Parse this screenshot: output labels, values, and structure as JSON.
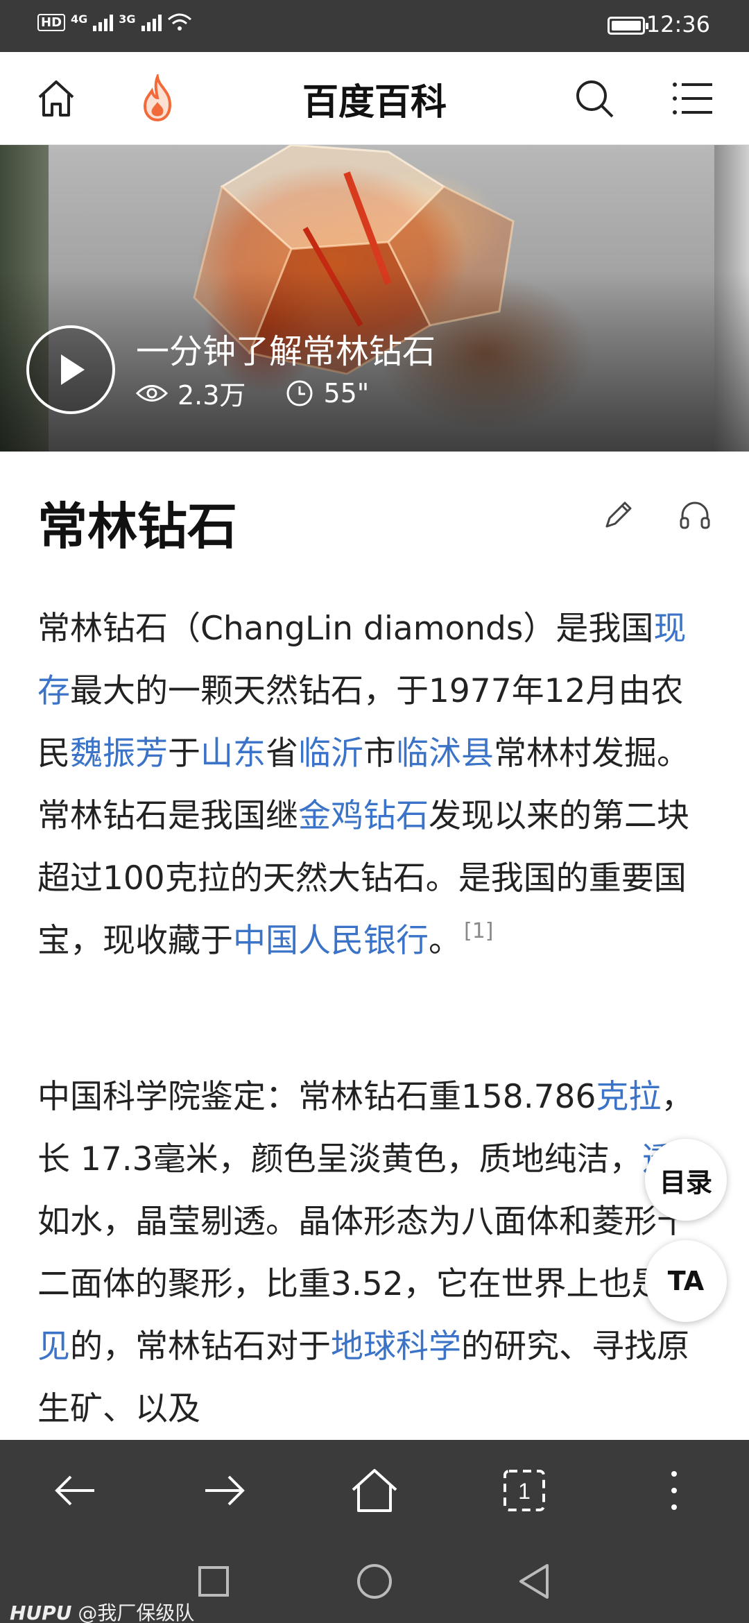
{
  "status_bar": {
    "hd": "HD",
    "sim1": "4G",
    "sim2": "3G",
    "time": "12:36"
  },
  "header": {
    "title": "百度百科",
    "icons": [
      "home-icon",
      "fire-icon",
      "search-icon",
      "menu-icon"
    ],
    "fire_color": "#f26a3a"
  },
  "video": {
    "title": "一分钟了解常林钻石",
    "views": "2.3万",
    "duration": "55\""
  },
  "article": {
    "title": "常林钻石",
    "link_color": "#3a73c7",
    "p1": [
      {
        "t": "常林钻石（ChangLin diamonds）是我国"
      },
      {
        "t": "现存",
        "link": true
      },
      {
        "t": "最大的一颗天然钻石，于1977年12月由农民"
      },
      {
        "t": "魏振芳",
        "link": true
      },
      {
        "t": "于"
      },
      {
        "t": "山东",
        "link": true
      },
      {
        "t": "省"
      },
      {
        "t": "临沂",
        "link": true
      },
      {
        "t": "市"
      },
      {
        "t": "临沭县",
        "link": true
      },
      {
        "t": "常林村发掘。常林钻石是我国继"
      },
      {
        "t": "金鸡钻石",
        "link": true
      },
      {
        "t": "发现以来的第二块超过100克拉的天然大钻石。是我国的重要国宝，现收藏于"
      },
      {
        "t": "中国人民银行",
        "link": true
      },
      {
        "t": "。"
      }
    ],
    "p1_ref": "[1]",
    "p2": [
      {
        "t": "中国科学院鉴定：常林钻石重158.786"
      },
      {
        "t": "克拉",
        "link": true
      },
      {
        "t": "，长 17.3毫米，颜色呈淡黄色，质地纯洁，"
      },
      {
        "t": "透明",
        "link": true
      },
      {
        "t": "如水，晶莹剔透。晶体形态为八面体和菱形十二面体的聚形，比重3.52，它在世界上也是"
      },
      {
        "t": "罕见",
        "link": true
      },
      {
        "t": "的，常林钻石对于"
      },
      {
        "t": "地球科学",
        "link": true
      },
      {
        "t": "的研究、寻找原生矿、以及"
      }
    ]
  },
  "floating": {
    "toc": "目录",
    "ta": "TA"
  },
  "watermark": {
    "brand": "HUPU",
    "text": "@我厂保级队"
  }
}
